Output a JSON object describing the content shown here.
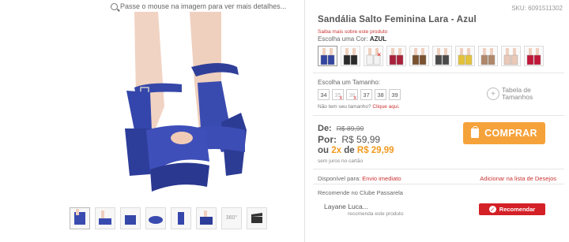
{
  "gallery": {
    "hint": "Passe o mouse na imagem para ver mais detalhes...",
    "thumb_360_label": "360°"
  },
  "product": {
    "sku": "SKU: 6091511302",
    "title": "Sandália Salto Feminina Lara - Azul",
    "more_link": "Saiba mais sobre este produto",
    "color_label": "Escolha uma Cor:",
    "color_value": "AZUL",
    "swatch_colors": [
      "#3346a0",
      "#2a2a2a",
      "#f3f3f3",
      "#a9213b",
      "#7a5230",
      "#4a4a4a",
      "#e3c23a",
      "#b0876a",
      "#e9c9b8",
      "#c0183a"
    ],
    "size_label": "Escolha um Tamanho:",
    "sizes": [
      "34",
      "35",
      "36",
      "37",
      "38",
      "39"
    ],
    "size_help": "Não tem seu tamanho?",
    "size_help_link": "Clique aqui.",
    "size_table_line1": "Tabela de",
    "size_table_line2": "Tamanhos"
  },
  "price": {
    "de_label": "De:",
    "de_value": "R$ 89,99",
    "por_label": "Por:",
    "por_value": "R$ 59,99",
    "ou_label": "ou",
    "installments": "2x",
    "de_word": "de",
    "installment_value": "R$ 29,99",
    "no_interest": "sem juros no cartão"
  },
  "buy": {
    "label": "COMPRAR"
  },
  "availability": {
    "label": "Disponível para:",
    "value": "Envio imediato",
    "wishlist": "Adicionar na lista de Desejos"
  },
  "recommend": {
    "label": "Recomende no Clube Passarela",
    "user": "Layane Luca...",
    "user_sub": "recomenda este produto",
    "button": "Recomendar"
  },
  "colors": {
    "accent": "#f6a23a",
    "brand_red": "#d42027",
    "link_red": "#cc3333"
  }
}
